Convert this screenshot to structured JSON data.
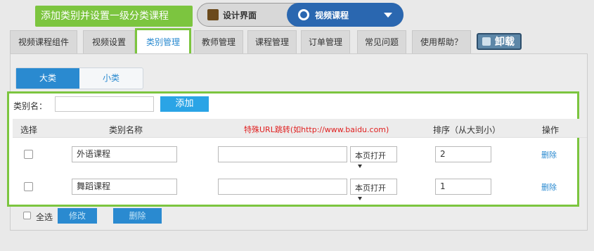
{
  "callout": "添加类别并设置一级分类课程",
  "topbar": {
    "design_label": "设计界面",
    "course_label": "视频课程"
  },
  "tabs": [
    "视频课程组件",
    "视频设置",
    "类别管理",
    "教师管理",
    "课程管理",
    "订单管理",
    "常见问题",
    "使用帮助？"
  ],
  "uninstall_label": "卸载",
  "segment": {
    "big": "大类",
    "small": "小类"
  },
  "form": {
    "name_label": "类别名：",
    "add_label": "添加"
  },
  "table": {
    "headers": {
      "select": "选择",
      "name": "类别名称",
      "redirect": "特殊URL跳转(如http://www.baidu.com)",
      "sort": "排序（从大到小）",
      "action": "操作"
    },
    "rows": [
      {
        "name": "外语课程",
        "url": "",
        "target": "本页打开",
        "sort": "2",
        "action": "删除"
      },
      {
        "name": "舞蹈课程",
        "url": "",
        "target": "本页打开",
        "sort": "1",
        "action": "删除"
      }
    ]
  },
  "bottom": {
    "select_all": "全选",
    "modify": "修改",
    "delete": "删除"
  },
  "colors": {
    "accent_green": "#7cc53f",
    "primary_blue": "#2a8ad0",
    "redirect_red": "#e02020"
  }
}
